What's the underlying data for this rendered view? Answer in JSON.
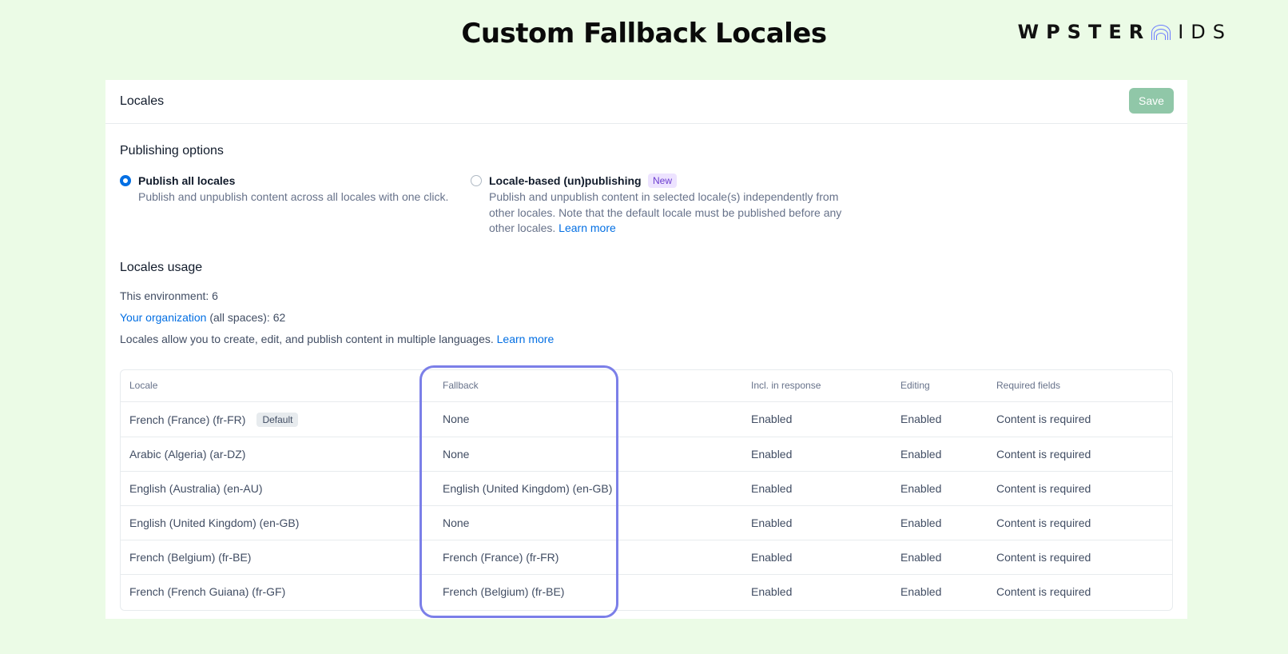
{
  "banner": {
    "title": "Custom Fallback Locales",
    "brand_left": "WPSTER",
    "brand_right": "IDS"
  },
  "header": {
    "title": "Locales",
    "save_label": "Save"
  },
  "publishing": {
    "title": "Publishing options",
    "option_all": {
      "label": "Publish all locales",
      "description": "Publish and unpublish content across all locales with one click.",
      "selected": true
    },
    "option_locale": {
      "label": "Locale-based (un)publishing",
      "badge": "New",
      "description_lines": [
        "Publish and unpublish content in selected locale(s) independently from",
        "other locales. Note that the default locale must be published before any",
        "other locales."
      ],
      "learn_more": "Learn more",
      "selected": false
    }
  },
  "usage": {
    "title": "Locales usage",
    "environment": "This environment: 6",
    "org_link": "Your organization",
    "org_rest": " (all spaces): 62",
    "info": "Locales allow you to create, edit, and publish content in multiple languages. ",
    "learn_more": "Learn more"
  },
  "table": {
    "headers": [
      "Locale",
      "Fallback",
      "Incl. in response",
      "Editing",
      "Required fields"
    ],
    "rows": [
      {
        "locale": "French (France) (fr-FR)",
        "badge": "Default",
        "fallback": "None",
        "response": "Enabled",
        "editing": "Enabled",
        "required": "Content is required"
      },
      {
        "locale": "Arabic (Algeria) (ar-DZ)",
        "fallback": "None",
        "response": "Enabled",
        "editing": "Enabled",
        "required": "Content is required"
      },
      {
        "locale": "English (Australia) (en-AU)",
        "fallback": "English (United Kingdom) (en-GB)",
        "response": "Enabled",
        "editing": "Enabled",
        "required": "Content is required"
      },
      {
        "locale": "English (United Kingdom) (en-GB)",
        "fallback": "None",
        "response": "Enabled",
        "editing": "Enabled",
        "required": "Content is required"
      },
      {
        "locale": "French (Belgium) (fr-BE)",
        "fallback": "French (France) (fr-FR)",
        "response": "Enabled",
        "editing": "Enabled",
        "required": "Content is required"
      },
      {
        "locale": "French (French Guiana) (fr-GF)",
        "fallback": "French (Belgium) (fr-BE)",
        "response": "Enabled",
        "editing": "Enabled",
        "required": "Content is required"
      }
    ]
  },
  "colors": {
    "accent": "#036fe3",
    "save_button": "#90c7a8",
    "highlight": "#7b7fe8",
    "background": "#ebfbe6"
  }
}
